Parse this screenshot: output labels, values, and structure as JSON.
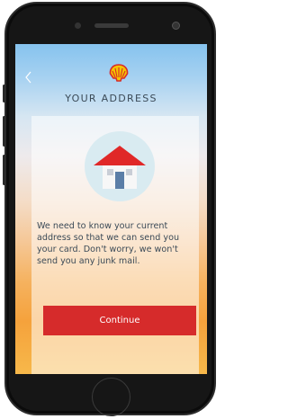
{
  "header": {
    "back_icon": "chevron-left-icon",
    "logo_icon": "shell-logo-icon",
    "title": "YOUR ADDRESS"
  },
  "main": {
    "illustration_icon": "house-icon",
    "message": "We need to know your current address so that we can send you your card. Don't worry, we won't send you any junk mail.",
    "continue_label": "Continue"
  },
  "colors": {
    "brand_red": "#d62b2b",
    "brand_yellow": "#f6c400",
    "text": "#3b4a57"
  }
}
